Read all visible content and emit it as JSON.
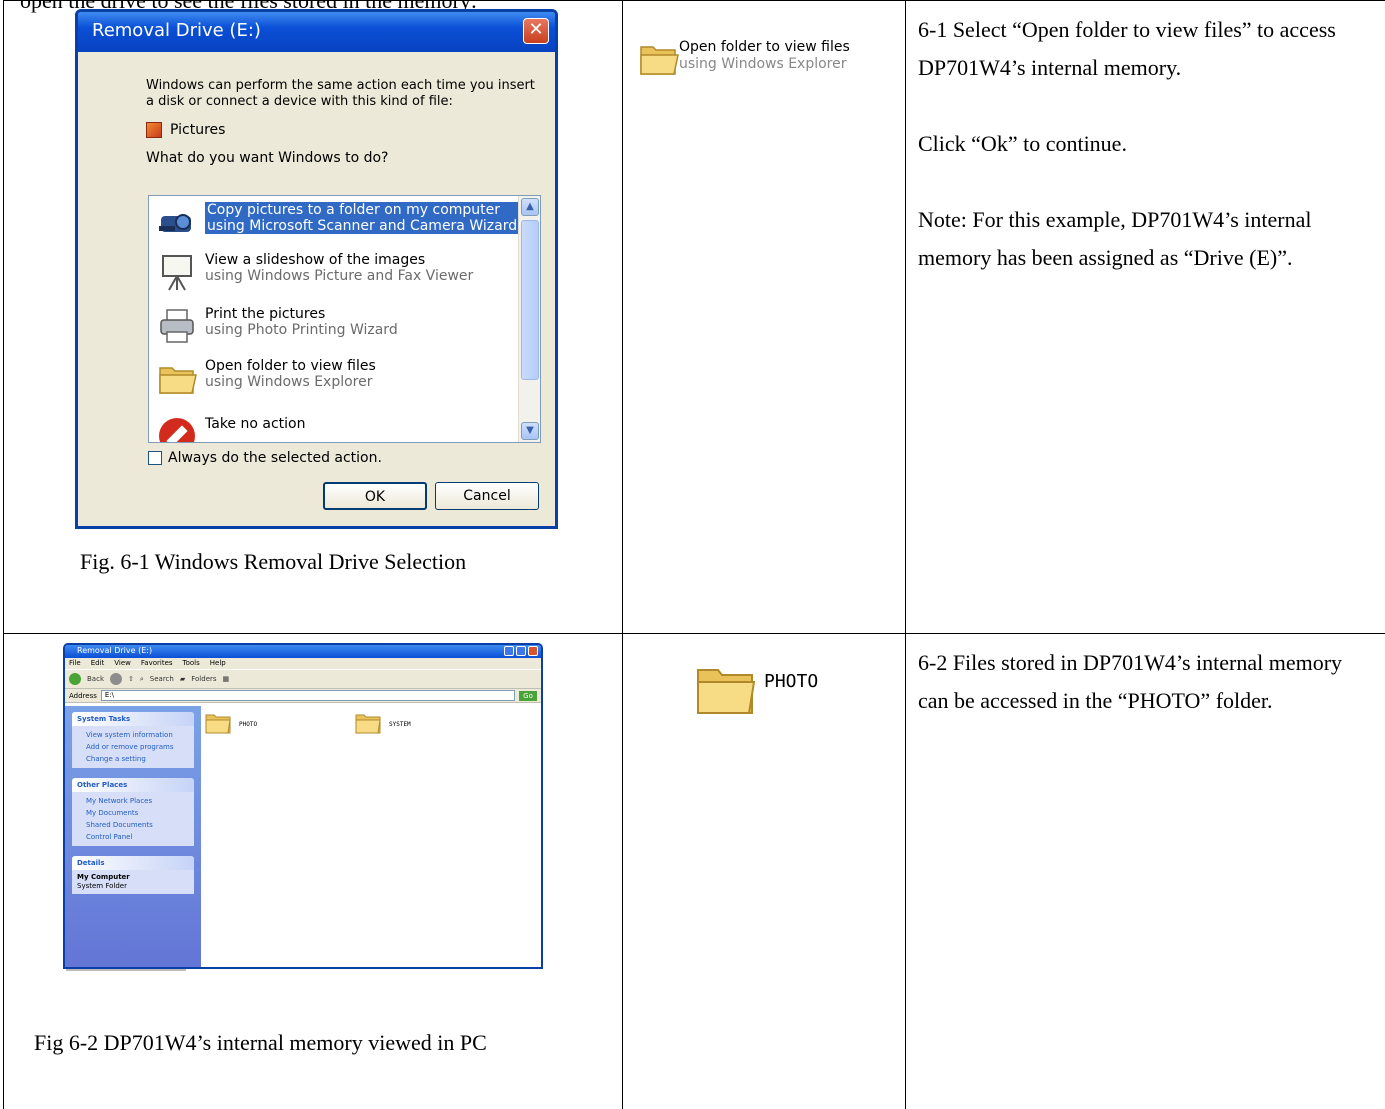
{
  "header_fragment": "open the drive to see the files stored in the memory:",
  "fig1": {
    "dialog_title": "Removal Drive (E:)",
    "close_glyph": "✕",
    "intro": "Windows can perform the same action each time you insert a disk or connect a device with this kind of file:",
    "content_type": "Pictures",
    "question": "What do you want Windows to do?",
    "items": [
      {
        "line1": "Copy pictures to a folder on my computer",
        "line2": "using Microsoft Scanner and Camera Wizard",
        "icon": "camera-icon"
      },
      {
        "line1": "View a slideshow of the images",
        "line2": "using Windows Picture and Fax Viewer",
        "icon": "projector-icon"
      },
      {
        "line1": "Print the pictures",
        "line2": "using Photo Printing Wizard",
        "icon": "printer-icon"
      },
      {
        "line1": "Open folder to view files",
        "line2": "using Windows Explorer",
        "icon": "folder-icon"
      },
      {
        "line1": "Take no action",
        "line2": "",
        "icon": "no-action-icon"
      }
    ],
    "checkbox_label": "Always do the selected action.",
    "ok_label": "OK",
    "cancel_label": "Cancel",
    "caption": "Fig. 6-1 Windows Removal Drive Selection"
  },
  "row1_middle": {
    "title": "Open folder to view files",
    "subtitle": "using Windows Explorer"
  },
  "row1_desc": {
    "p1": "6-1 Select “Open folder to view files” to access DP701W4’s internal memory.",
    "p2": "Click “Ok” to continue.",
    "p3": "Note: For this example, DP701W4’s internal memory has been assigned as “Drive (E)”."
  },
  "fig2": {
    "window_title": "Removal Drive (E:)",
    "menu": [
      "File",
      "Edit",
      "View",
      "Favorites",
      "Tools",
      "Help"
    ],
    "toolbar": {
      "back": "Back",
      "search": "Search",
      "folders": "Folders"
    },
    "address_label": "Address",
    "address_value": "E:\\",
    "go_label": "Go",
    "panels": [
      {
        "title": "System Tasks",
        "items": [
          "View system information",
          "Add or remove programs",
          "Change a setting"
        ]
      },
      {
        "title": "Other Places",
        "items": [
          "My Network Places",
          "My Documents",
          "Shared Documents",
          "Control Panel"
        ]
      },
      {
        "title": "Details",
        "bold": "My Computer",
        "sub": "System Folder"
      }
    ],
    "files": [
      "PHOTO",
      "SYSTEM"
    ],
    "caption": "Fig 6-2 DP701W4’s internal memory viewed in PC"
  },
  "row2_middle": {
    "label": "PHOTO"
  },
  "row2_desc": {
    "p1": "6-2 Files stored in DP701W4’s internal memory can be accessed in the “PHOTO” folder."
  }
}
